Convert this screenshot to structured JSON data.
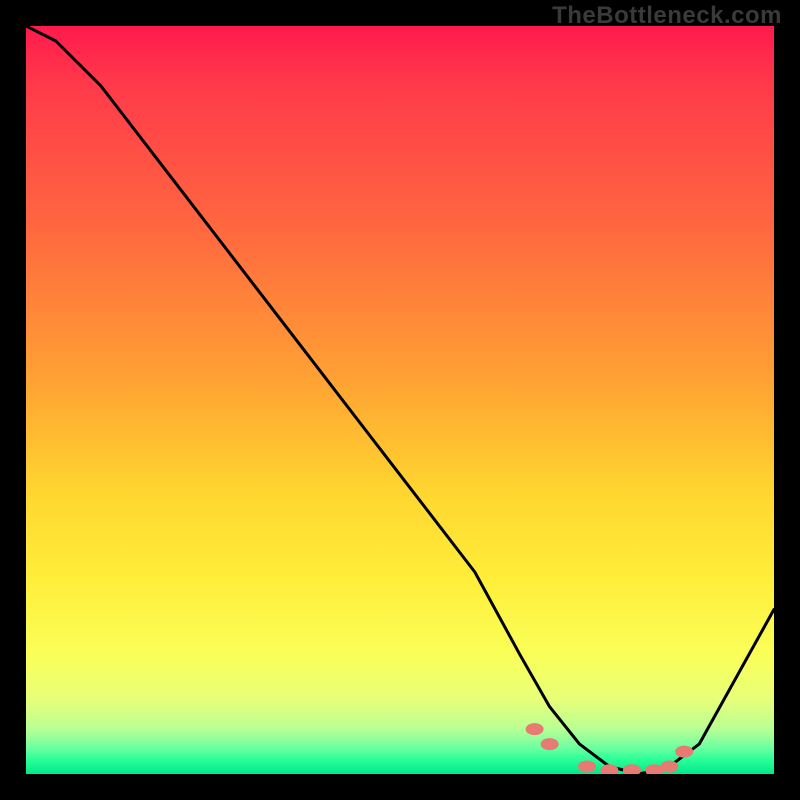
{
  "watermark": "TheBottleneck.com",
  "chart_data": {
    "type": "line",
    "title": "",
    "xlabel": "",
    "ylabel": "",
    "xlim": [
      0,
      100
    ],
    "ylim": [
      0,
      100
    ],
    "grid": false,
    "series": [
      {
        "name": "bottleneck-curve",
        "x": [
          0,
          4,
          10,
          20,
          30,
          40,
          50,
          60,
          66,
          70,
          74,
          78,
          82,
          86,
          90,
          100
        ],
        "y": [
          100,
          98,
          92,
          79,
          66,
          53,
          40,
          27,
          16,
          9,
          4,
          1,
          0,
          1,
          4,
          22
        ]
      }
    ],
    "markers": {
      "name": "highlight-dots",
      "color": "#e77a72",
      "points_x": [
        68,
        70,
        75,
        78,
        81,
        84,
        86,
        88
      ],
      "points_y": [
        6,
        4,
        1,
        0.5,
        0.5,
        0.5,
        1,
        3
      ]
    },
    "gradient_stops": [
      {
        "pos": 0,
        "color": "#ff1a4d"
      },
      {
        "pos": 0.28,
        "color": "#ff6a3f"
      },
      {
        "pos": 0.62,
        "color": "#ffd52f"
      },
      {
        "pos": 0.9,
        "color": "#e8ff78"
      },
      {
        "pos": 1.0,
        "color": "#00e88a"
      }
    ]
  }
}
